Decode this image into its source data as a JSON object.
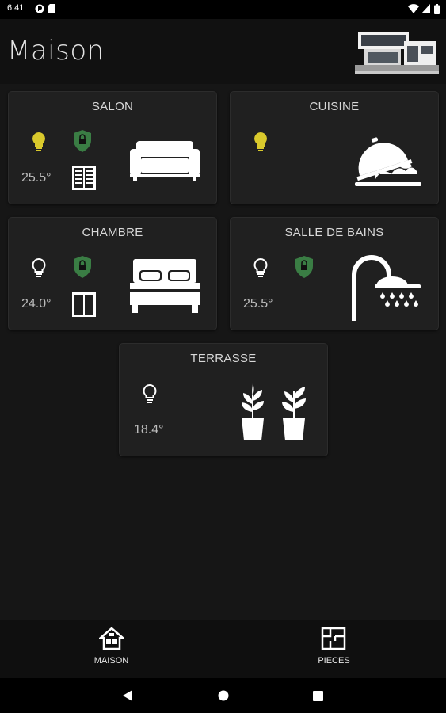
{
  "status_bar": {
    "time": "6:41"
  },
  "app": {
    "title": "Maison"
  },
  "rooms": [
    {
      "name": "SALON",
      "temperature": "25.5°"
    },
    {
      "name": "CUISINE"
    },
    {
      "name": "CHAMBRE",
      "temperature": "24.0°"
    },
    {
      "name": "SALLE DE BAINS",
      "temperature": "25.5°"
    },
    {
      "name": "TERRASSE",
      "temperature": "18.4°"
    }
  ],
  "colors": {
    "light_on": "#d9c92c",
    "lock_green": "#3a7d44",
    "background": "#161616",
    "card": "#202020"
  },
  "bottom_nav": {
    "items": [
      {
        "label": "MAISON",
        "icon": "house-icon"
      },
      {
        "label": "PIECES",
        "icon": "floor-plan-icon"
      }
    ]
  }
}
